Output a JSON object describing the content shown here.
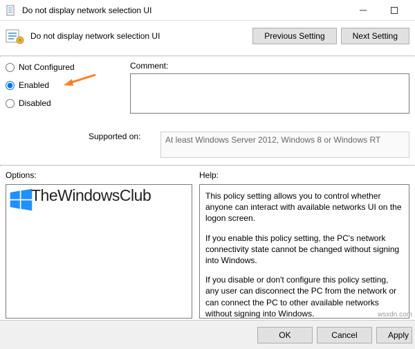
{
  "window": {
    "title": "Do not display network selection UI"
  },
  "toolbar": {
    "subtitle": "Do not display network selection UI",
    "prev_btn": "Previous Setting",
    "next_btn": "Next Setting"
  },
  "radios": {
    "not_configured": "Not Configured",
    "enabled": "Enabled",
    "disabled": "Disabled",
    "selected": "enabled"
  },
  "labels": {
    "comment": "Comment:",
    "supported": "Supported on:",
    "options": "Options:",
    "help": "Help:"
  },
  "supported_text": "At least Windows Server 2012, Windows 8 or Windows RT",
  "help": {
    "p1": "This policy setting allows you to control whether anyone can interact with available networks UI on the logon screen.",
    "p2": "If you enable this policy setting, the PC's network connectivity state cannot be changed without signing into Windows.",
    "p3": "If you disable or don't configure this policy setting, any user can disconnect the PC from the network or can connect the PC to other available networks without signing into Windows."
  },
  "footer": {
    "ok": "OK",
    "cancel": "Cancel",
    "apply": "Apply"
  },
  "watermark": {
    "brand": "TheWindowsClub",
    "corner": "wsxdn.com"
  }
}
